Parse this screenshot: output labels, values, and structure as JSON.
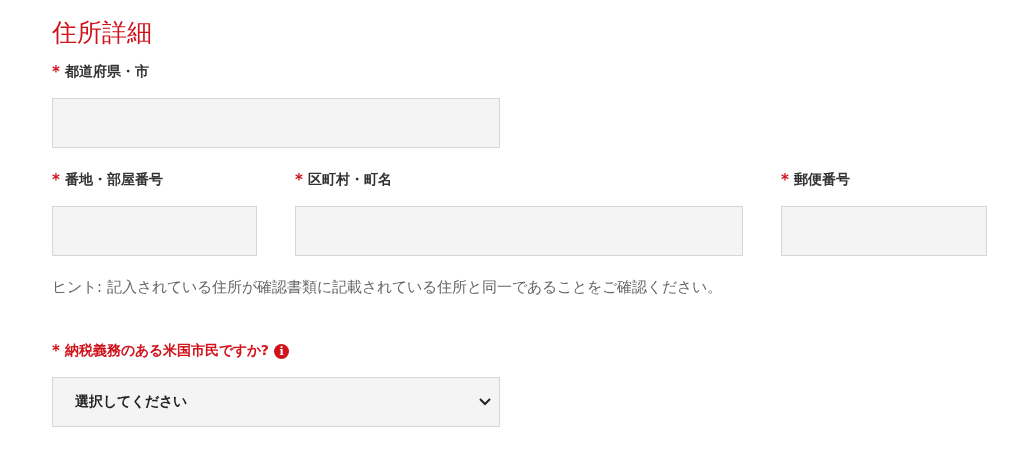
{
  "section_title": "住所詳細",
  "address_rows": [
    [
      {
        "mark": "*",
        "label": "都道府県・市",
        "highlighted": false
      }
    ],
    [
      {
        "mark": "*",
        "label": "番地・部屋番号",
        "highlighted": false
      },
      {
        "mark": "*",
        "label": "区町村・町名",
        "highlighted": false
      },
      {
        "mark": "*",
        "label": "郵便番号",
        "highlighted": false
      }
    ]
  ],
  "hint": "ヒント: 記入されている住所が確認書類に記載されている住所と同一であることをご確認ください。",
  "question": {
    "mark": "*",
    "label": "納税義務のある米国市民ですか?",
    "highlighted": true,
    "info_icon": "i",
    "select_value": "選択してください"
  }
}
